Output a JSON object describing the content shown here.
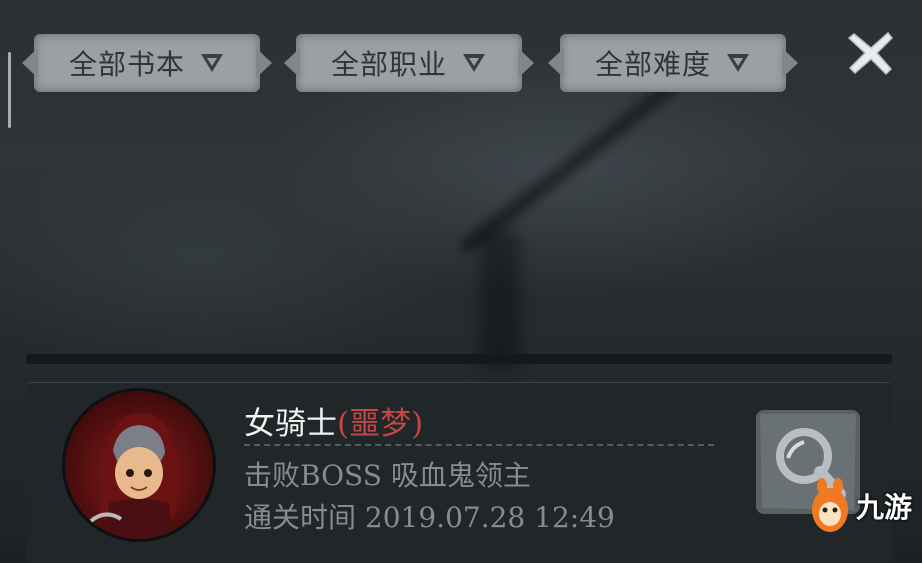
{
  "filters": [
    {
      "label": "全部书本"
    },
    {
      "label": "全部职业"
    },
    {
      "label": "全部难度"
    }
  ],
  "record": {
    "hero_name": "女骑士",
    "difficulty": "(噩梦)",
    "defeat_label": "击败BOSS",
    "boss_name": "吸血鬼领主",
    "clear_time_label": "通关时间",
    "clear_time": "2019.07.28 12:49"
  },
  "watermark": {
    "text": "九游"
  },
  "colors": {
    "difficulty": "#c24646",
    "tab_bg": "#9aa0a3",
    "card_bg": "#21262a"
  },
  "icons": {
    "close": "close-x-icon",
    "filter_arrow": "triangle-down-icon",
    "search": "magnifier-icon"
  }
}
